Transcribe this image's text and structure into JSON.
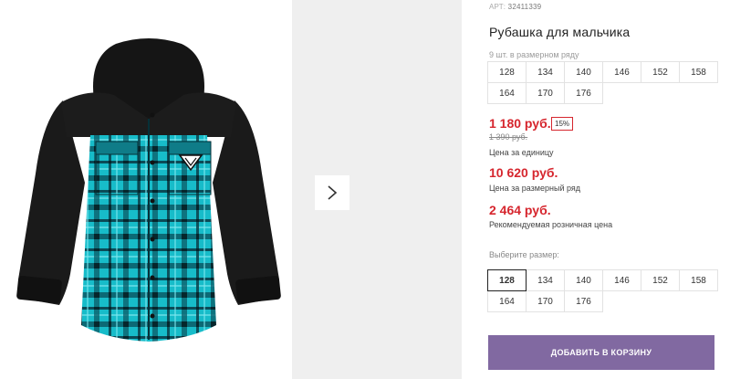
{
  "product": {
    "sku_label": "АРТ:",
    "sku_value": "32411339",
    "title": "Рубашка для мальчика",
    "pack_note": "9 шт. в размерном ряду"
  },
  "pack_sizes": [
    "128",
    "134",
    "140",
    "146",
    "152",
    "158",
    "164",
    "170",
    "176"
  ],
  "prices": {
    "unit_price": "1 180 руб.",
    "discount": "15%",
    "old_price": "1 390 руб.",
    "unit_caption": "Цена за единицу",
    "row_price": "10 620 руб.",
    "row_caption": "Цена за размерный ряд",
    "retail_price": "2 464 руб.",
    "retail_caption": "Рекомендуемая розничная цена",
    "accent_color": "#d6262e"
  },
  "size_selector": {
    "prompt": "Выберите размер:",
    "options": [
      "128",
      "134",
      "140",
      "146",
      "152",
      "158",
      "164",
      "170",
      "176"
    ],
    "selected": "128"
  },
  "cart_button": {
    "label": "ДОБАВИТЬ В КОРЗИНУ",
    "color": "#8169a1"
  },
  "gallery": {
    "next_icon": "chevron-right-icon"
  }
}
